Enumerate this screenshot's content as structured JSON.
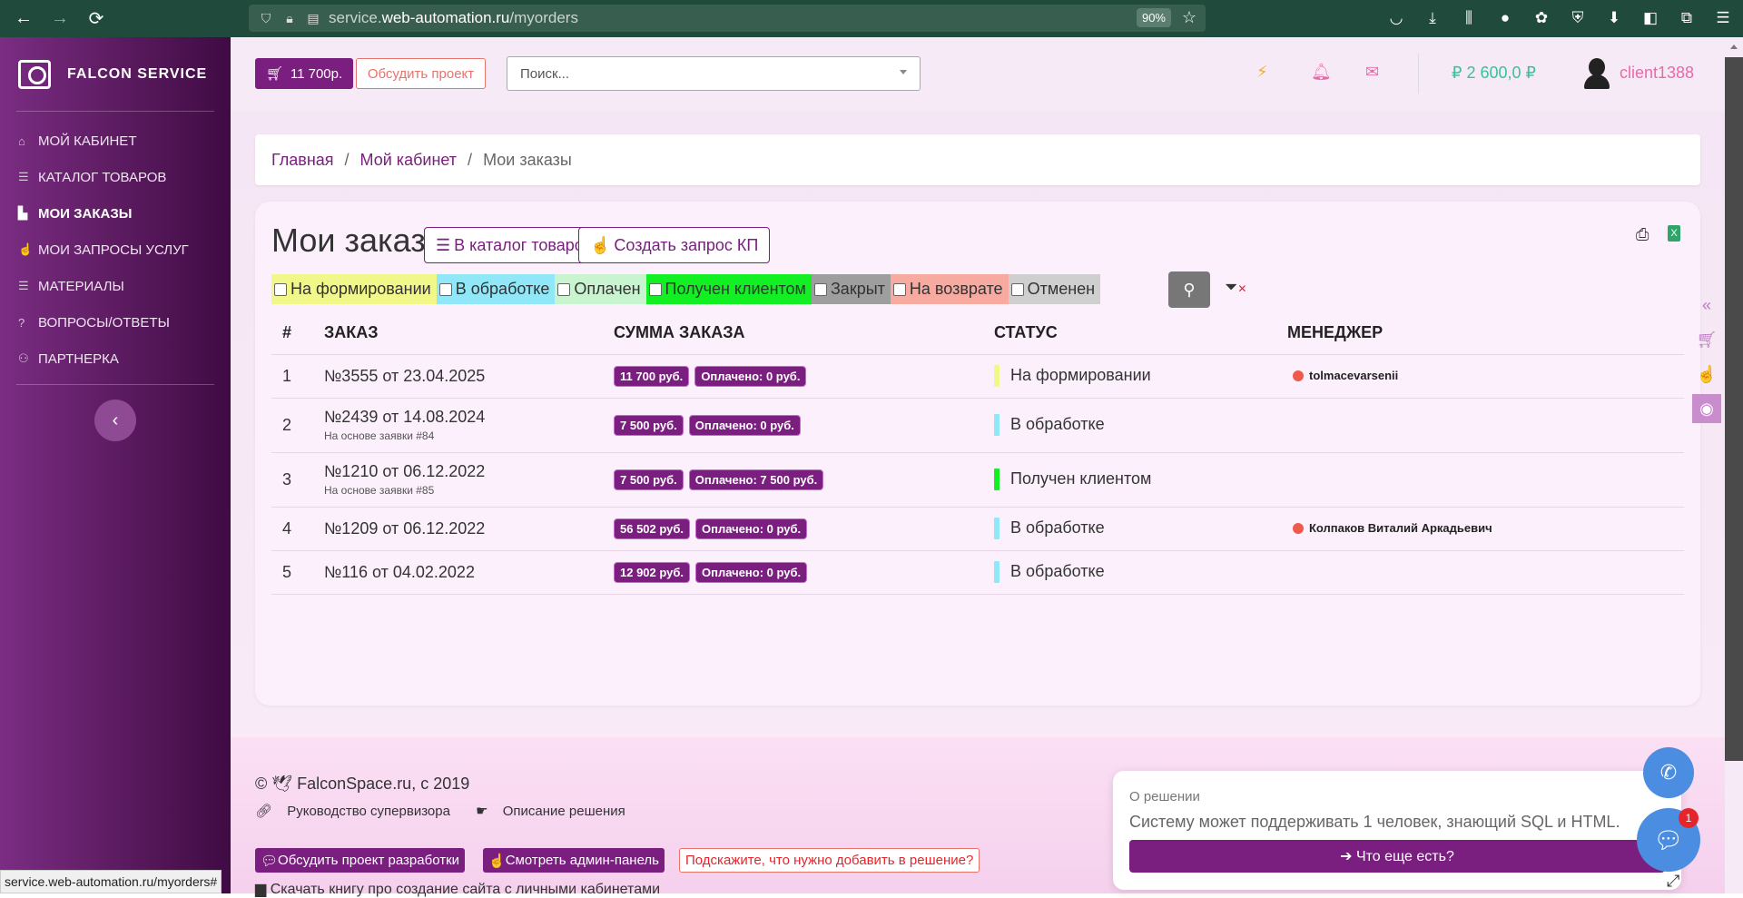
{
  "browser": {
    "url_prefix": "service.",
    "url_domain": "web-automation.ru",
    "url_path": "/myorders",
    "zoom": "90%"
  },
  "sidebar": {
    "logo": "FALCON SERVICE",
    "items": [
      {
        "label": "МОЙ КАБИНЕТ",
        "icon": "home-icon"
      },
      {
        "label": "КАТАЛОГ ТОВАРОВ",
        "icon": "list-icon"
      },
      {
        "label": "МОИ ЗАКАЗЫ",
        "icon": "bag-icon",
        "active": true
      },
      {
        "label": "МОИ ЗАПРОСЫ УСЛУГ",
        "icon": "hand-icon"
      },
      {
        "label": "МАТЕРИАЛЫ",
        "icon": "list-icon"
      },
      {
        "label": "ВОПРОСЫ/ОТВЕТЫ",
        "icon": "question-icon"
      },
      {
        "label": "ПАРТНЕРКА",
        "icon": "users-icon"
      }
    ]
  },
  "topbar": {
    "cart": "11 700р.",
    "discuss": "Обсудить проект",
    "search_placeholder": "Поиск...",
    "balance": "2 600,0 ₽",
    "username": "client1388"
  },
  "breadcrumb": {
    "home": "Главная",
    "cabinet": "Мой кабинет",
    "current": "Мои заказы"
  },
  "page": {
    "title": "Мои заказы",
    "catalog_btn": "В каталог товаров",
    "request_btn": "Создать запрос КП"
  },
  "filters": [
    {
      "label": "На формировании",
      "color": "#f2f78a"
    },
    {
      "label": "В обработке",
      "color": "#8fe7f7"
    },
    {
      "label": "Оплачен",
      "color": "#c8f5cf"
    },
    {
      "label": "Получен клиентом",
      "color": "#12f024"
    },
    {
      "label": "Закрыт",
      "color": "#9e9e9e"
    },
    {
      "label": "На возврате",
      "color": "#f6aaa0"
    },
    {
      "label": "Отменен",
      "color": "#cfcfcf"
    }
  ],
  "table": {
    "headers": [
      "#",
      "ЗАКАЗ",
      "СУММА ЗАКАЗА",
      "СТАТУС",
      "МЕНЕДЖЕР"
    ],
    "rows": [
      {
        "n": "1",
        "order": "№3555 от 23.04.2025",
        "sub": "",
        "sum": "11 700 руб.",
        "paid": "Оплачено: 0 руб.",
        "status": "На формировании",
        "status_color": "#f2f78a",
        "manager": "tolmacevarsenii"
      },
      {
        "n": "2",
        "order": "№2439 от 14.08.2024",
        "sub": "На основе заявки #84",
        "sum": "7 500 руб.",
        "paid": "Оплачено: 0 руб.",
        "status": "В обработке",
        "status_color": "#8fe7f7",
        "manager": ""
      },
      {
        "n": "3",
        "order": "№1210 от 06.12.2022",
        "sub": "На основе заявки #85",
        "sum": "7 500 руб.",
        "paid": "Оплачено: 7 500 руб.",
        "status": "Получен клиентом",
        "status_color": "#12f024",
        "manager": ""
      },
      {
        "n": "4",
        "order": "№1209 от 06.12.2022",
        "sub": "",
        "sum": "56 502 руб.",
        "paid": "Оплачено: 0 руб.",
        "status": "В обработке",
        "status_color": "#8fe7f7",
        "manager": "Колпаков Виталий Аркадьевич"
      },
      {
        "n": "5",
        "order": "№116 от 04.02.2022",
        "sub": "",
        "sum": "12 902 руб.",
        "paid": "Оплачено: 0 руб.",
        "status": "В обработке",
        "status_color": "#8fe7f7",
        "manager": ""
      }
    ]
  },
  "footer": {
    "copyright": "© ",
    "brand": "FalconSpace.ru, с 2019",
    "link1": "Руководство супервизора",
    "link2": "Описание решения",
    "btn1": "Обсудить проект разработки",
    "btn2": "Смотреть админ-панель",
    "btn3": "Подскажите, что нужно добавить в решение?",
    "download": "Скачать книгу про создание сайта с личными кабинетами",
    "status_url": "service.web-automation.ru/myorders#"
  },
  "promo": {
    "title": "О решении",
    "text": "Систему может поддерживать 1 человек, знающий SQL и HTML.",
    "btn": "➔ Что еще есть?",
    "chat_badge": "1"
  }
}
